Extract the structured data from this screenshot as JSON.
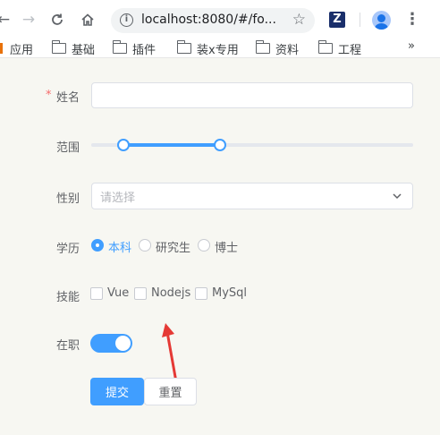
{
  "browser": {
    "url": "localhost:8080/#/fo...",
    "bookmarks": [
      "应用",
      "基础",
      "插件",
      "装x专用",
      "资料",
      "工程"
    ],
    "more": "»",
    "ext_letter": "Z"
  },
  "form": {
    "name_label": "姓名",
    "required_mark": "*",
    "range_label": "范围",
    "range_value": [
      10,
      40
    ],
    "gender_label": "性别",
    "gender_placeholder": "请选择",
    "education_label": "学历",
    "education_options": [
      {
        "label": "本科",
        "checked": true
      },
      {
        "label": "研究生",
        "checked": false
      },
      {
        "label": "博士",
        "checked": false
      }
    ],
    "skills_label": "技能",
    "skills_options": [
      {
        "label": "Vue",
        "checked": false
      },
      {
        "label": "Nodejs",
        "checked": false
      },
      {
        "label": "MySql",
        "checked": false
      }
    ],
    "employed_label": "在职",
    "employed": true,
    "submit_label": "提交",
    "reset_label": "重置"
  },
  "colors": {
    "primary": "#409eff",
    "annotation_arrow": "#e53935",
    "required": "#f56c6c"
  }
}
